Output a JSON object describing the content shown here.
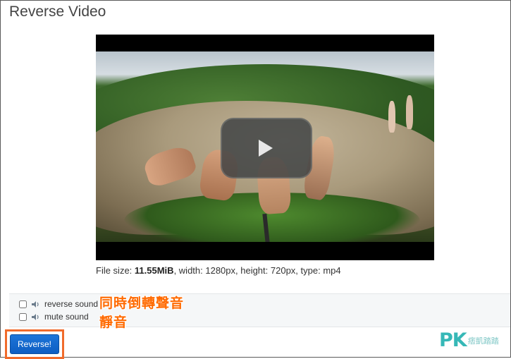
{
  "page": {
    "title": "Reverse Video"
  },
  "video": {
    "info_prefix": "File size: ",
    "file_size": "11.55MiB",
    "info_suffix": ", width: 1280px, height: 720px, type: mp4"
  },
  "options": {
    "reverse_sound_label": "reverse sound",
    "mute_sound_label": "mute sound"
  },
  "annotations": {
    "reverse_sound_note": "同時倒轉聲音",
    "mute_note": "靜音"
  },
  "actions": {
    "reverse_label": "Reverse!"
  },
  "watermark": {
    "brand": "PK",
    "sub": "痞凱踏踏"
  },
  "colors": {
    "accent_button": "#0e5ec3",
    "highlight": "#f06b2b",
    "annotation": "#ff6a00",
    "watermark": "#36b8b7"
  },
  "icons": {
    "speaker": "speaker-icon",
    "play": "play-icon"
  }
}
